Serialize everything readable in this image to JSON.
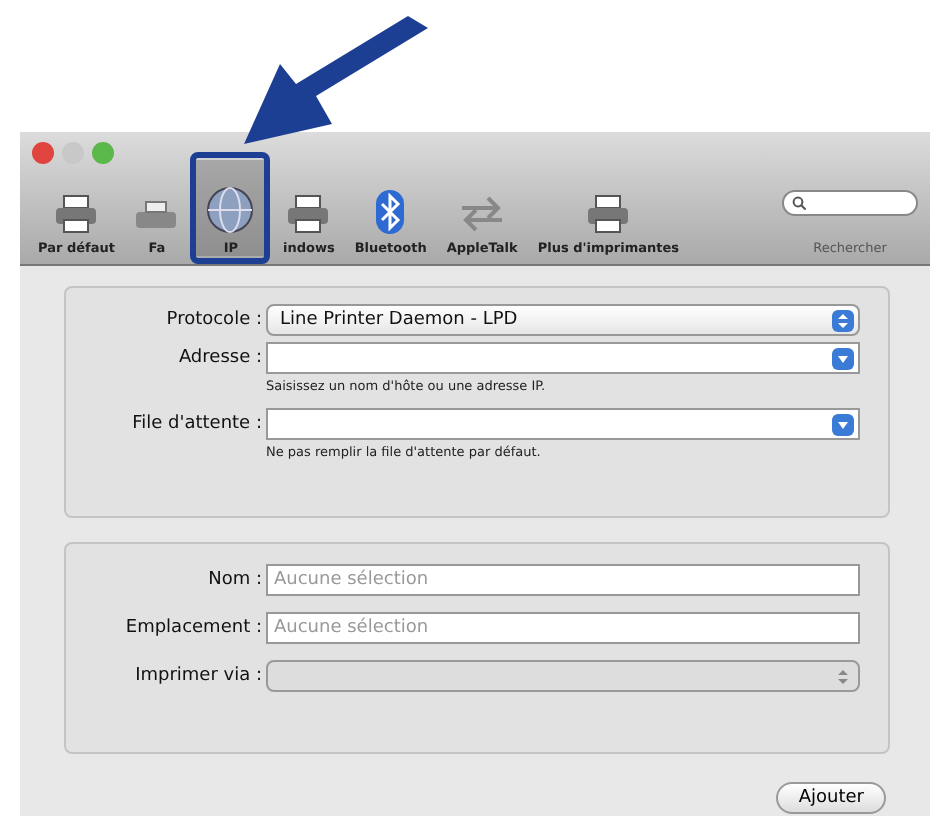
{
  "toolbar": {
    "items": [
      {
        "label": "Par défaut",
        "kind": "printer",
        "selected": false
      },
      {
        "label": "Fa",
        "kind": "fax",
        "selected": false
      },
      {
        "label": "IP",
        "kind": "network",
        "selected": true
      },
      {
        "label": "indows",
        "kind": "printer",
        "selected": false
      },
      {
        "label": "Bluetooth",
        "kind": "bluetooth",
        "selected": false
      },
      {
        "label": "AppleTalk",
        "kind": "appletalk",
        "selected": false
      },
      {
        "label": "Plus d'imprimantes",
        "kind": "printer",
        "selected": false
      }
    ],
    "search": {
      "label": "Rechercher"
    }
  },
  "connection": {
    "rows": [
      {
        "kind": "select",
        "label": "Protocole :",
        "value": "Line Printer Daemon - LPD"
      },
      {
        "kind": "combo",
        "label": "Adresse :",
        "value": "",
        "hint": "Saisissez un nom d'hôte ou une adresse IP."
      },
      {
        "kind": "combo",
        "label": "File d'attente :",
        "value": "",
        "hint": "Ne pas remplir la file d'attente par défaut."
      }
    ]
  },
  "details": {
    "rows": [
      {
        "kind": "text",
        "label": "Nom :",
        "placeholder": "Aucune sélection"
      },
      {
        "kind": "text",
        "label": "Emplacement :",
        "placeholder": "Aucune sélection"
      },
      {
        "kind": "select",
        "label": "Imprimer via :",
        "value": "",
        "disabled": true
      }
    ]
  },
  "button": "Ajouter"
}
